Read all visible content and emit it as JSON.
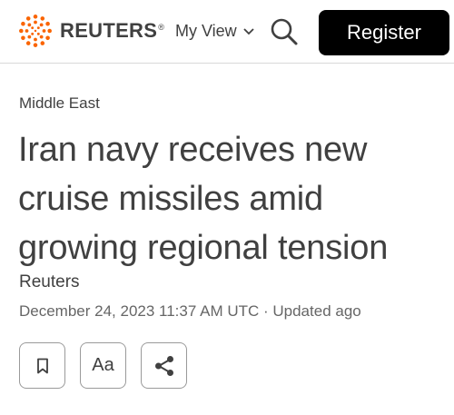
{
  "header": {
    "logo_text": "REUTERS",
    "logo_mark": "®",
    "my_view_label": "My View",
    "my_view_icon": "chevron-down-icon",
    "search_icon": "search-icon",
    "register_label": "Register"
  },
  "article": {
    "section": "Middle East",
    "headline_lines": [
      "Iran navy receives new",
      "cruise missiles amid",
      "growing regional tension"
    ],
    "byline": "Reuters",
    "dateline": "December 24, 2023 11:37 AM UTC · Updated ago"
  },
  "actions": {
    "bookmark_icon": "bookmark-icon",
    "text_size_label": "Aa",
    "share_icon": "share-icon"
  },
  "colors": {
    "brand_orange": "#fa6400",
    "text": "#404040",
    "button_bg": "#000000"
  }
}
